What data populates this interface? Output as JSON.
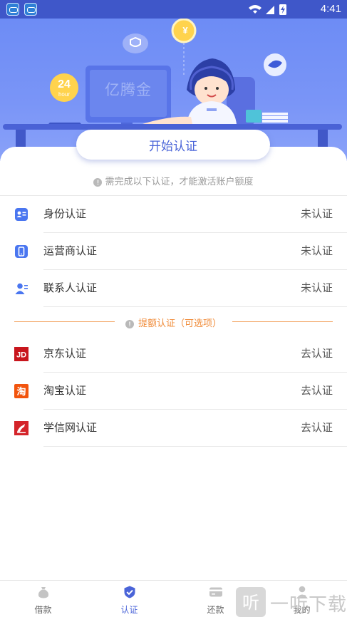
{
  "status_bar": {
    "time": "4:41"
  },
  "hero": {
    "monitor_text": "亿腾金",
    "badge_number": "24",
    "badge_unit": "hour",
    "coin_symbol": "¥"
  },
  "start_button_label": "开始认证",
  "notice": "需完成以下认证，才能激活账户额度",
  "required_items": [
    {
      "label": "身份认证",
      "status": "未认证",
      "icon": "id-card-icon"
    },
    {
      "label": "运营商认证",
      "status": "未认证",
      "icon": "phone-icon"
    },
    {
      "label": "联系人认证",
      "status": "未认证",
      "icon": "contact-icon"
    }
  ],
  "optional_divider": "提额认证（可选项）",
  "optional_items": [
    {
      "label": "京东认证",
      "status": "去认证",
      "icon": "jd-icon",
      "color": "#c8161d",
      "mark": "JD"
    },
    {
      "label": "淘宝认证",
      "status": "去认证",
      "icon": "taobao-icon",
      "color": "#f2540d",
      "mark": "淘"
    },
    {
      "label": "学信网认证",
      "status": "去认证",
      "icon": "xuexin-icon",
      "color": "#d4242a",
      "mark": ""
    }
  ],
  "tabs": [
    {
      "label": "借款",
      "icon": "money-bag-icon",
      "active": false
    },
    {
      "label": "认证",
      "icon": "shield-check-icon",
      "active": true
    },
    {
      "label": "还款",
      "icon": "card-icon",
      "active": false
    },
    {
      "label": "我的",
      "icon": "user-icon",
      "active": false
    }
  ],
  "watermark": {
    "text": "一听下载",
    "glyph": "听"
  },
  "colors": {
    "accent": "#4a64d8",
    "orange": "#f08c3a",
    "hero_top": "#6d8cf5"
  }
}
